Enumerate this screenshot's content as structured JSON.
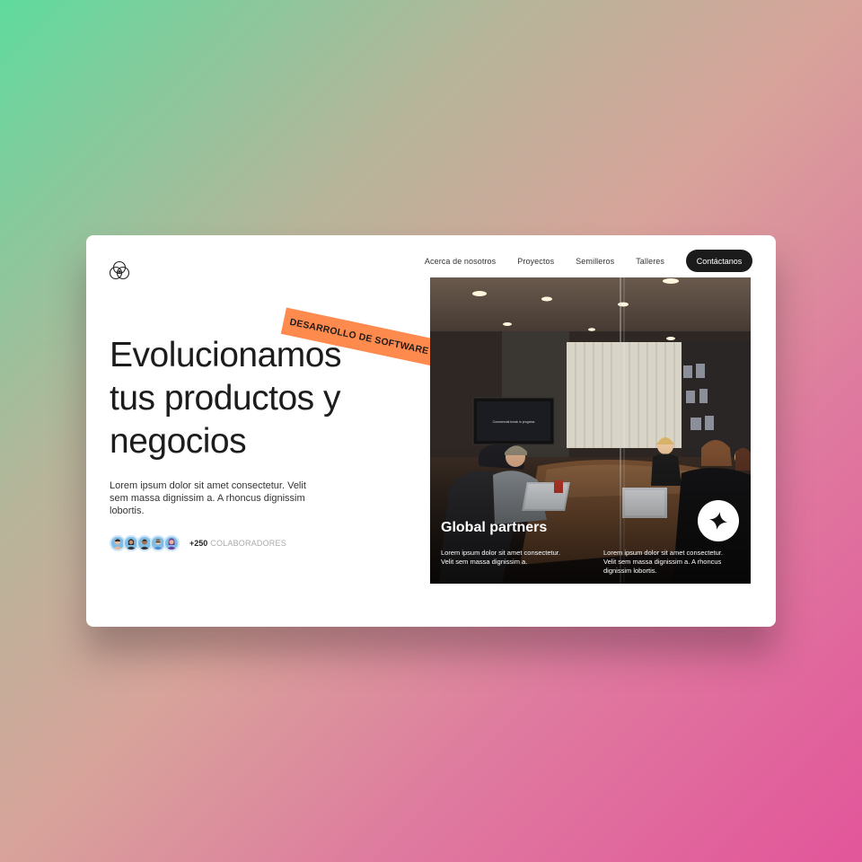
{
  "nav": {
    "links": [
      "Acerca de nosotros",
      "Proyectos",
      "Semilleros",
      "Talleres"
    ],
    "cta": "Contáctanos"
  },
  "hero": {
    "tag": "DESARROLLO DE SOFTWARE",
    "title_lines": [
      "Evolucionamos",
      "tus productos y",
      "negocios"
    ],
    "description": "Lorem ipsum dolor sit amet consectetur. Velit sem massa dignissim a. A rhoncus dignissim lobortis.",
    "collaborators_count": "+250",
    "collaborators_label": "COLABORADORES"
  },
  "feature": {
    "title": "Global partners",
    "text_left": "Lorem ipsum dolor sit amet consectetur. Velit sem massa dignissim a.",
    "text_right": "Lorem ipsum dolor sit amet consectetur. Velit sem massa dignissim a. A rhoncus dignissim lobortis.",
    "screen_text": "Commercial break in progress"
  },
  "colors": {
    "accent": "#ff8a4d",
    "dark": "#1b1b1b",
    "avatar_ring": "#cfe6f7"
  },
  "icons": [
    "logo-icon",
    "sparkle-star-icon"
  ]
}
